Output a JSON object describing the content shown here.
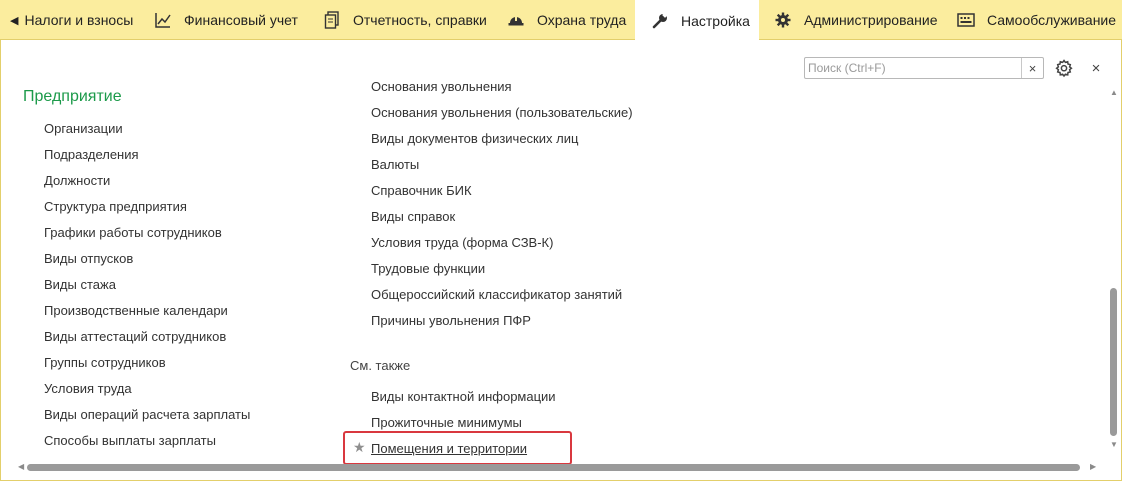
{
  "tabs": [
    {
      "label": "Налоги и взносы",
      "icon": "left-arrow-icon",
      "active": false
    },
    {
      "label": "Финансовый учет",
      "icon": "chart-icon",
      "active": false
    },
    {
      "label": "Отчетность, справки",
      "icon": "documents-icon",
      "active": false
    },
    {
      "label": "Охрана труда",
      "icon": "helmet-icon",
      "active": false
    },
    {
      "label": "Настройка",
      "icon": "wrench-icon",
      "active": true
    },
    {
      "label": "Администрирование",
      "icon": "gear-icon",
      "active": false
    },
    {
      "label": "Самообслуживание",
      "icon": "keyboard-icon",
      "active": false
    }
  ],
  "search": {
    "placeholder": "Поиск (Ctrl+F)",
    "clear_glyph": "×"
  },
  "window": {
    "close_glyph": "×"
  },
  "left": {
    "title": "Предприятие",
    "items": [
      "Организации",
      "Подразделения",
      "Должности",
      "Структура предприятия",
      "Графики работы сотрудников",
      "Виды отпусков",
      "Виды стажа",
      "Производственные календари",
      "Виды аттестаций сотрудников",
      "Группы сотрудников",
      "Условия труда",
      "Виды операций расчета зарплаты",
      "Способы выплаты зарплаты"
    ]
  },
  "right": {
    "items": [
      "Основания увольнения",
      "Основания увольнения (пользовательские)",
      "Виды документов физических лиц",
      "Валюты",
      "Справочник БИК",
      "Виды справок",
      "Условия труда (форма СЗВ-К)",
      "Трудовые функции",
      "Общероссийский классификатор занятий",
      "Причины увольнения ПФР"
    ],
    "see_also_title": "См. также",
    "see_also": [
      "Виды контактной информации",
      "Прожиточные минимумы",
      "Помещения и территории"
    ]
  },
  "colors": {
    "tabbar_bg": "#fbed9e",
    "section_title": "#1c9a4a",
    "highlight_border": "#d9383f"
  }
}
